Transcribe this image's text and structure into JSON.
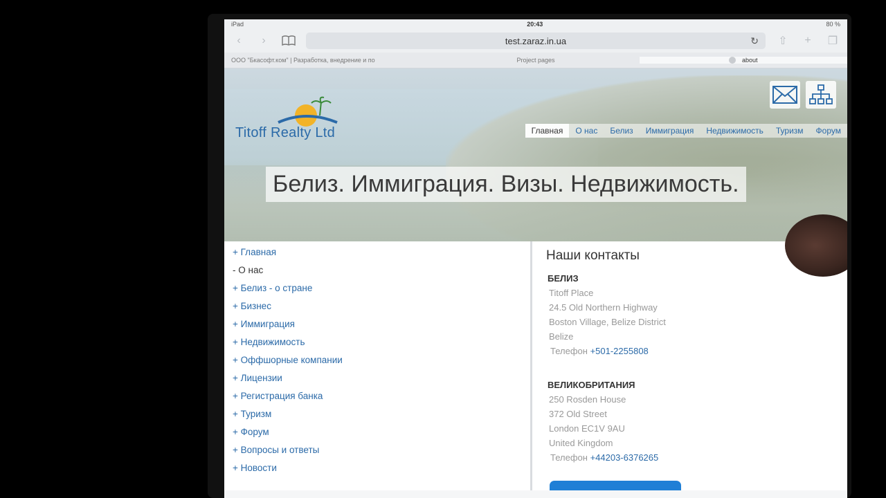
{
  "status": {
    "device": "iPad",
    "time": "20:43",
    "battery": "80 %"
  },
  "browser": {
    "url": "test.zaraz.in.ua"
  },
  "tabs": [
    {
      "label": "ООО \"Бкасофт.ком\" | Разработка, внедрение и по"
    },
    {
      "label": "Project pages"
    },
    {
      "label": "about"
    }
  ],
  "site": {
    "logo_text": "Titoff Realty Ltd",
    "nav": [
      "Главная",
      "О нас",
      "Белиз",
      "Иммиграция",
      "Недвижимость",
      "Туризм",
      "Форум"
    ],
    "headline": "Белиз. Иммиграция. Визы. Недвижимость."
  },
  "sidebar": {
    "items": [
      "+ Главная",
      "- О нас",
      "+ Белиз - о стране",
      "+ Бизнес",
      "+ Иммиграция",
      "+ Недвижимость",
      "+ Оффшорные компании",
      "+ Лицензии",
      "+ Регистрация банка",
      "+ Туризм",
      "+ Форум",
      "+ Вопросы и ответы",
      "+ Новости"
    ]
  },
  "contacts": {
    "title": "Наши контакты",
    "belize": {
      "country": "БЕЛИЗ",
      "lines": [
        "Titoff Place",
        "24.5 Old Northern Highway",
        "Boston Village, Belize District",
        "Belize"
      ],
      "phone_label": "Телефон",
      "phone": "+501-2255808"
    },
    "uk": {
      "country": "ВЕЛИКОБРИТАНИЯ",
      "lines": [
        "250 Rosden House",
        "372 Old Street",
        "London EC1V 9AU",
        "United Kingdom"
      ],
      "phone_label": "Телефон",
      "phone": "+44203-6376265"
    }
  },
  "colors": {
    "accent": "#2b6aa8",
    "text": "#333333",
    "muted": "#999999"
  }
}
